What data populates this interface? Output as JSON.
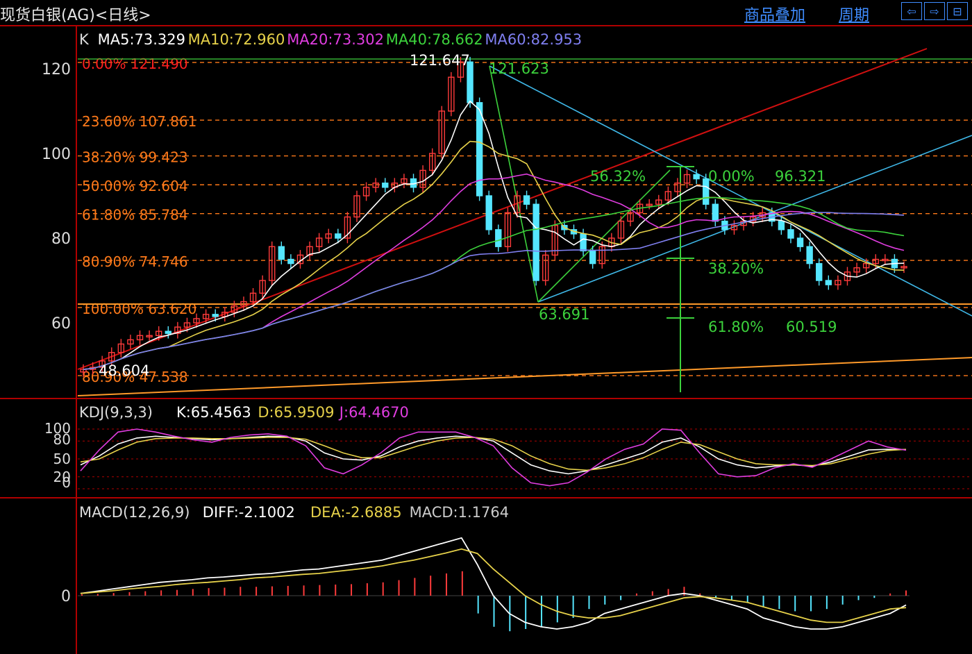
{
  "header": {
    "title": "现货白银(AG)<日线>",
    "overlay_label": "商品叠加",
    "period_label": "周期",
    "nav_left": "⇦",
    "nav_right": "⇨",
    "nav_full": "⊟"
  },
  "colors": {
    "bg": "#000000",
    "frame": "#b00000",
    "up": "#ff3b3b",
    "down": "#55e6ff",
    "ma5": "#ffffff",
    "ma10": "#e7d24a",
    "ma20": "#e03de0",
    "ma40": "#3cd23c",
    "ma60": "#7f7ff0",
    "fib": "#ff7a1a",
    "trend_red": "#d01010",
    "trend_cyan": "#3fb8e8"
  },
  "chart_data": [
    {
      "type": "candlestick",
      "ylim": [
        44,
        128
      ],
      "yticks": [
        60,
        80,
        100,
        120
      ],
      "legend": {
        "prefix": "K",
        "items": [
          {
            "name": "MA5",
            "text": "MA5:73.329",
            "color": "#ffffff"
          },
          {
            "name": "MA10",
            "text": "MA10:72.960",
            "color": "#e7d24a"
          },
          {
            "name": "MA20",
            "text": "MA20:73.302",
            "color": "#e03de0"
          },
          {
            "name": "MA40",
            "text": "MA40:78.662",
            "color": "#3cd23c"
          },
          {
            "name": "MA60",
            "text": "MA60:82.953",
            "color": "#7f7ff0"
          }
        ]
      },
      "fib_levels": [
        {
          "text": "0.00% 121.490",
          "value": 121.49
        },
        {
          "text": "23.60% 107.861",
          "value": 107.861
        },
        {
          "text": "38.20% 99.423",
          "value": 99.423
        },
        {
          "text": "50.00% 92.604",
          "value": 92.604
        },
        {
          "text": "61.80% 85.784",
          "value": 85.784
        },
        {
          "text": "80.90% 74.746",
          "value": 74.746
        },
        {
          "text": "100.00% 63.620",
          "value": 63.62
        },
        {
          "text": "80.90% 47.538",
          "value": 47.538
        }
      ],
      "annotations": [
        {
          "text": "121.647",
          "value": 121.647
        },
        {
          "text": "121.623",
          "value": 121.623
        },
        {
          "text": "48.604",
          "value": 48.604
        },
        {
          "text": "63.691",
          "value": 63.691
        },
        {
          "text": "56.32%"
        },
        {
          "text": "0.00%"
        },
        {
          "text": "96.321",
          "value": 96.321
        },
        {
          "text": "38.20%"
        },
        {
          "text": "61.80%"
        },
        {
          "text": "60.519",
          "value": 60.519
        }
      ],
      "closes": [
        49,
        49.5,
        51,
        53,
        55,
        56,
        57,
        57,
        58,
        57.5,
        59,
        60,
        61,
        62,
        61.5,
        62.5,
        64,
        65,
        67,
        70,
        78,
        75,
        74,
        76,
        78,
        80,
        81,
        80,
        85,
        90,
        92,
        93,
        92,
        93,
        94,
        92,
        96,
        100,
        110,
        118,
        121.6,
        112,
        90,
        82,
        78,
        86,
        90,
        88,
        70,
        76,
        83,
        82,
        81,
        77,
        74,
        78,
        80,
        84,
        86,
        88,
        88,
        89,
        91,
        93,
        95,
        94,
        88,
        84,
        82,
        83,
        84,
        85,
        86,
        84,
        82,
        80,
        78,
        74,
        70,
        69,
        70,
        72,
        73,
        74,
        75,
        75,
        73,
        73.3
      ]
    },
    {
      "type": "line",
      "legend": {
        "prefix": "KDJ(9,3,3)",
        "items": [
          {
            "name": "K",
            "text": "K:65.4563",
            "color": "#ffffff"
          },
          {
            "name": "D",
            "text": "D:65.9509",
            "color": "#e7d24a"
          },
          {
            "name": "J",
            "text": "J:64.4670",
            "color": "#e03de0"
          }
        ]
      },
      "ylim": [
        0,
        100
      ],
      "yticks": [
        100,
        80,
        50,
        20,
        0
      ],
      "series": [
        {
          "name": "K",
          "values": [
            40,
            55,
            75,
            85,
            88,
            86,
            84,
            82,
            84,
            86,
            88,
            87,
            80,
            60,
            50,
            48,
            55,
            70,
            80,
            85,
            88,
            86,
            80,
            60,
            40,
            30,
            25,
            30,
            40,
            50,
            60,
            78,
            85,
            70,
            50,
            40,
            35,
            38,
            40,
            38,
            45,
            55,
            65,
            66,
            65.5
          ]
        },
        {
          "name": "D",
          "values": [
            45,
            50,
            65,
            78,
            84,
            85,
            85,
            84,
            84,
            85,
            86,
            86,
            83,
            72,
            60,
            52,
            52,
            62,
            72,
            80,
            85,
            86,
            83,
            72,
            55,
            42,
            33,
            31,
            35,
            42,
            52,
            66,
            78,
            74,
            62,
            50,
            42,
            40,
            40,
            39,
            42,
            50,
            58,
            64,
            66
          ]
        },
        {
          "name": "J",
          "values": [
            30,
            65,
            95,
            100,
            95,
            88,
            82,
            78,
            86,
            90,
            92,
            88,
            72,
            35,
            25,
            40,
            60,
            85,
            95,
            95,
            95,
            86,
            72,
            35,
            10,
            5,
            10,
            28,
            50,
            66,
            75,
            100,
            98,
            60,
            25,
            20,
            22,
            35,
            42,
            36,
            50,
            65,
            80,
            70,
            64.5
          ]
        }
      ]
    },
    {
      "type": "bar",
      "legend": {
        "prefix": "MACD(12,26,9)",
        "items": [
          {
            "name": "DIFF",
            "text": "DIFF:-2.1002",
            "color": "#ffffff"
          },
          {
            "name": "DEA",
            "text": "DEA:-2.6885",
            "color": "#e7d24a"
          },
          {
            "name": "MACD",
            "text": "MACD:1.1764",
            "color": "#cccccc"
          }
        ]
      },
      "yticks": [
        0
      ],
      "ylim": [
        -14,
        14
      ],
      "series": [
        {
          "name": "DIFF",
          "values": [
            0.5,
            1,
            1.5,
            2,
            2.5,
            3,
            3.3,
            3.6,
            4,
            4.2,
            4.5,
            4.8,
            5,
            5.4,
            5.8,
            6,
            6.5,
            7,
            7.5,
            8,
            9,
            10,
            11,
            12,
            13,
            7,
            0,
            -4,
            -6,
            -7,
            -7.5,
            -7,
            -6,
            -4,
            -3,
            -2,
            -1,
            0,
            0.5,
            0,
            -1,
            -2,
            -3,
            -5,
            -6,
            -7,
            -7.5,
            -7.5,
            -7,
            -6,
            -5,
            -4,
            -2.1
          ]
        },
        {
          "name": "DEA",
          "values": [
            0.5,
            0.8,
            1.1,
            1.5,
            1.8,
            2.1,
            2.5,
            2.8,
            3,
            3.3,
            3.6,
            4,
            4.2,
            4.5,
            4.8,
            5,
            5.4,
            5.8,
            6.2,
            6.7,
            7.4,
            8,
            8.8,
            9.6,
            10.5,
            9.5,
            6,
            3,
            0,
            -2,
            -3.5,
            -4.5,
            -5,
            -5,
            -4.5,
            -3.5,
            -2.5,
            -1.5,
            -0.5,
            -0.2,
            -0.5,
            -1,
            -1.5,
            -2.5,
            -3.5,
            -4.5,
            -5.5,
            -6,
            -6,
            -5,
            -4,
            -3,
            -2.6885
          ]
        },
        {
          "name": "MACD",
          "values": [
            0.3,
            0.4,
            0.6,
            0.8,
            1,
            1.2,
            1.3,
            1.5,
            1.7,
            1.8,
            2,
            2,
            2.1,
            2.2,
            2.3,
            2.4,
            2.5,
            2.6,
            2.8,
            3,
            3.5,
            4,
            4.5,
            5,
            5.5,
            -4,
            -7,
            -8,
            -7.5,
            -7,
            -6,
            -5,
            -3,
            -2,
            -1,
            0.5,
            1,
            1.5,
            2,
            0.5,
            -0.5,
            -1,
            -1.5,
            -2.5,
            -3,
            -3.5,
            -3.5,
            -3,
            -2,
            -1,
            -0.5,
            0.5,
            1.1764
          ]
        }
      ]
    }
  ]
}
